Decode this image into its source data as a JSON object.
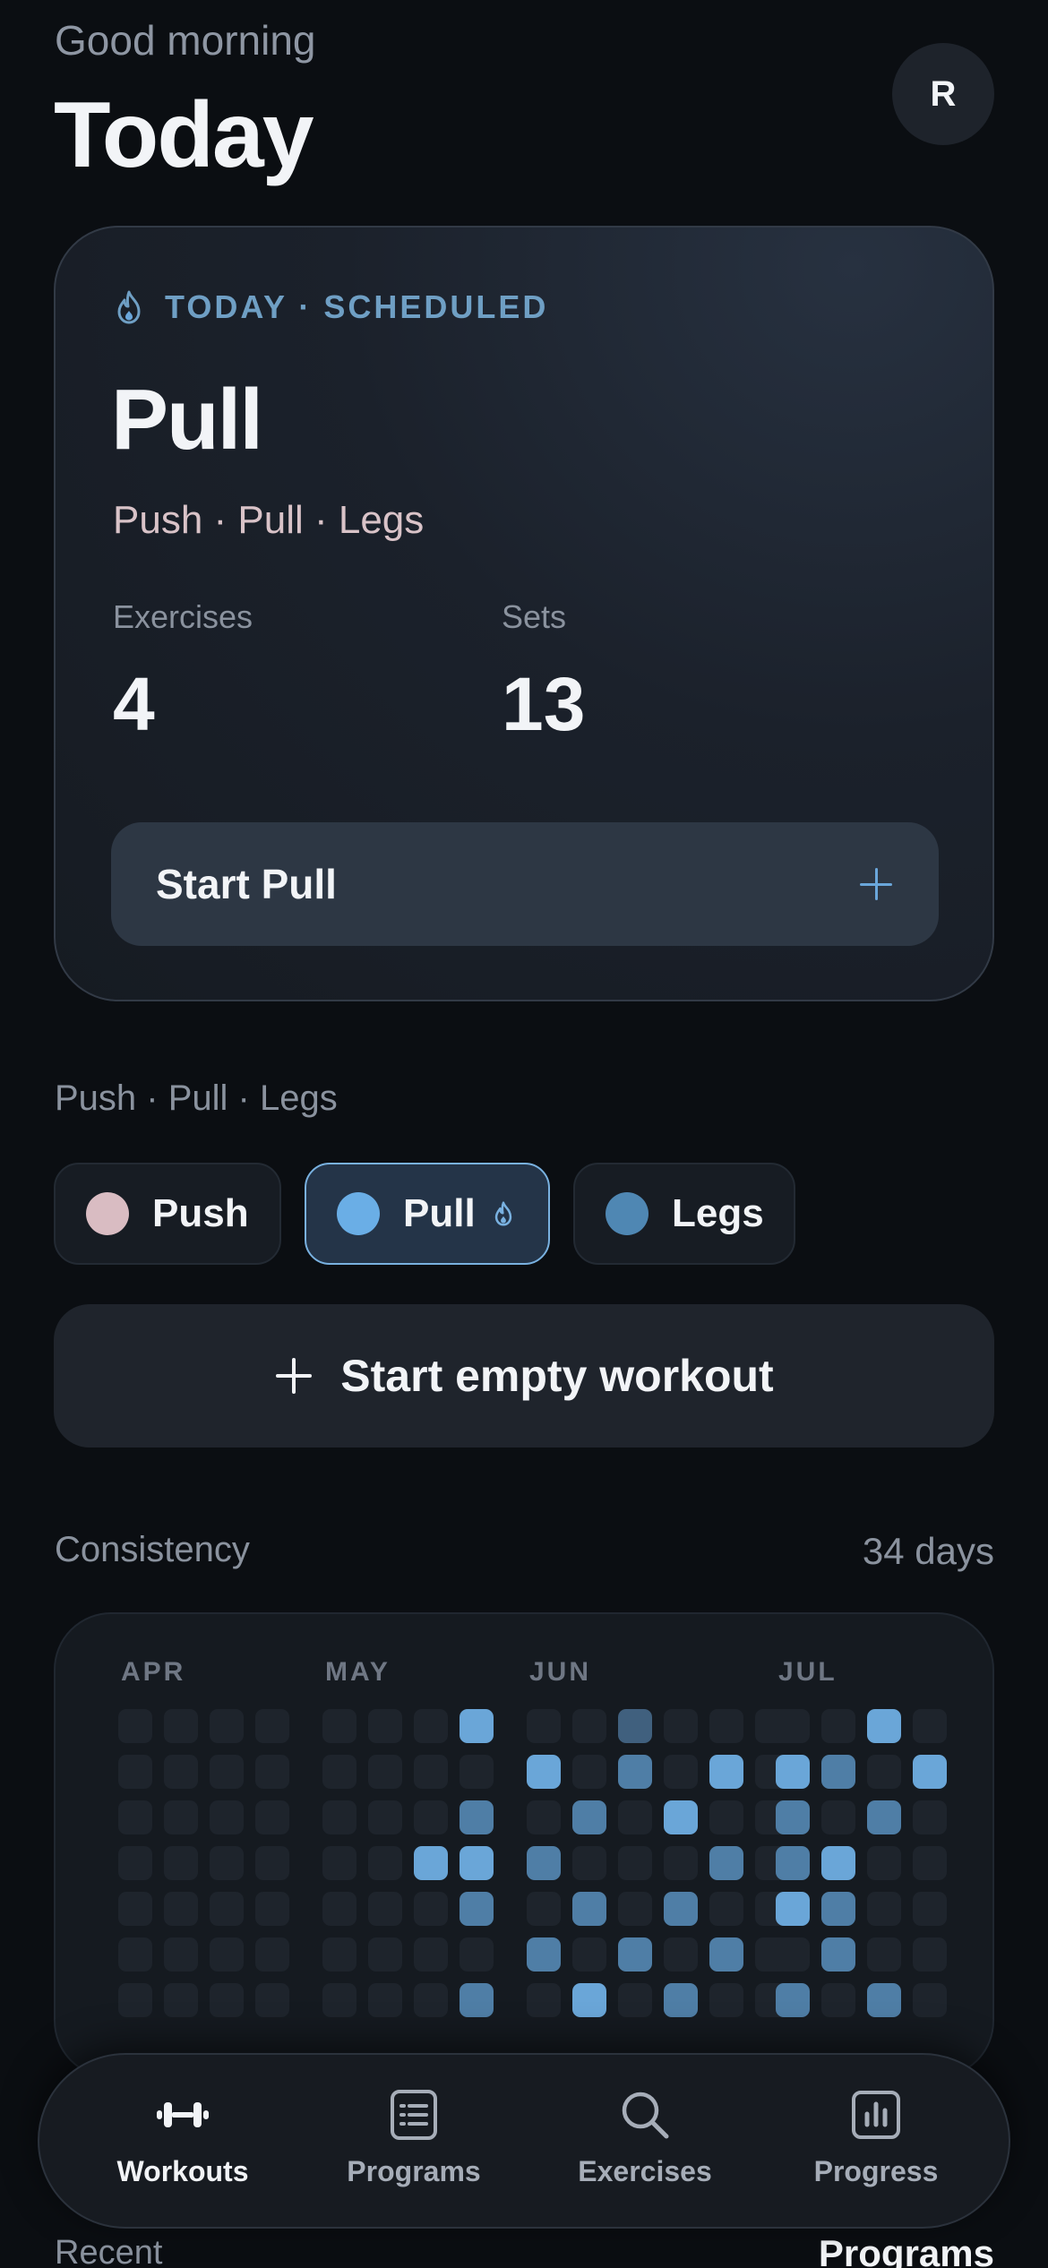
{
  "header": {
    "greeting": "Good morning",
    "title": "Today",
    "avatar_initial": "R"
  },
  "today_card": {
    "tag": "TODAY · SCHEDULED",
    "tag_icon": "flame-icon",
    "workout_name": "Pull",
    "program_name": "Push · Pull · Legs",
    "stats": [
      {
        "label": "Exercises",
        "value": "4"
      },
      {
        "label": "Sets",
        "value": "13"
      }
    ],
    "start_label": "Start Pull"
  },
  "program": {
    "label": "Push · Pull · Legs",
    "days": [
      {
        "label": "Push",
        "color": "#d9bcc2",
        "selected": false
      },
      {
        "label": "Pull",
        "color": "#6aaee6",
        "selected": true
      },
      {
        "label": "Legs",
        "color": "#4f87b3",
        "selected": false
      }
    ]
  },
  "empty_workout_label": "Start empty workout",
  "consistency": {
    "label": "Consistency",
    "days_text": "34 days",
    "months": [
      "APR",
      "MAY",
      "JUN",
      "JUL"
    ],
    "colors": {
      "0": "#1e242c",
      "1": "#40607e",
      "2": "#4f7ea6",
      "3": "#6aa6d8"
    },
    "grid": [
      [
        "0000",
        "0003",
        "001000",
        "0030"
      ],
      [
        "0000",
        "0000",
        "302030",
        "3203"
      ],
      [
        "0000",
        "0002",
        "020300",
        "2020"
      ],
      [
        "0000",
        "0033",
        "200020",
        "2300"
      ],
      [
        "0000",
        "0002",
        "020200",
        "3200"
      ],
      [
        "0000",
        "0000",
        "202020",
        "0200"
      ],
      [
        "0000",
        "0002",
        "030200",
        "2020"
      ]
    ]
  },
  "nav": {
    "items": [
      {
        "label": "Workouts",
        "icon": "dumbbell-icon",
        "active": true
      },
      {
        "label": "Programs",
        "icon": "list-icon",
        "active": false
      },
      {
        "label": "Exercises",
        "icon": "search-icon",
        "active": false
      },
      {
        "label": "Progress",
        "icon": "chart-icon",
        "active": false
      }
    ]
  },
  "recent": {
    "label": "Recent",
    "link": "Programs"
  }
}
